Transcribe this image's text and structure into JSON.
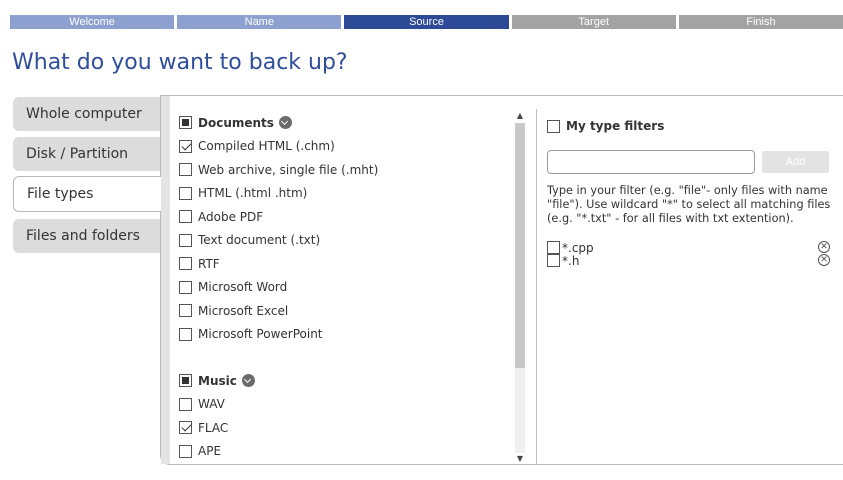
{
  "wizard": {
    "steps": [
      {
        "label": "Welcome",
        "state": "done"
      },
      {
        "label": "Name",
        "state": "done"
      },
      {
        "label": "Source",
        "state": "active"
      },
      {
        "label": "Target",
        "state": "todo"
      },
      {
        "label": "Finish",
        "state": "todo"
      }
    ]
  },
  "page_title": "What do you want to back up?",
  "sidebar": {
    "items": [
      {
        "label": "Whole computer",
        "selected": false
      },
      {
        "label": "Disk / Partition",
        "selected": false
      },
      {
        "label": "File types",
        "selected": true
      },
      {
        "label": "Files and folders",
        "selected": false
      }
    ]
  },
  "types": {
    "documents": {
      "label": "Documents",
      "state": "partial",
      "items": [
        {
          "label": "Compiled HTML (.chm)",
          "checked": true
        },
        {
          "label": "Web archive, single file (.mht)",
          "checked": false
        },
        {
          "label": "HTML (.html .htm)",
          "checked": false
        },
        {
          "label": "Adobe PDF",
          "checked": false
        },
        {
          "label": "Text document (.txt)",
          "checked": false
        },
        {
          "label": "RTF",
          "checked": false
        },
        {
          "label": "Microsoft Word",
          "checked": false
        },
        {
          "label": "Microsoft Excel",
          "checked": false
        },
        {
          "label": "Microsoft PowerPoint",
          "checked": false
        }
      ]
    },
    "music": {
      "label": "Music",
      "state": "partial",
      "items": [
        {
          "label": "WAV",
          "checked": false
        },
        {
          "label": "FLAC",
          "checked": true
        },
        {
          "label": "APE",
          "checked": false
        }
      ]
    }
  },
  "filters": {
    "header": "My type filters",
    "input_value": "",
    "add_label": "Add",
    "help": "Type in your filter (e.g. \"file\"- only files with name \"file\"). Use wildcard \"*\" to select all matching files (e.g. \"*.txt\" - for all files with txt extention).",
    "items": [
      {
        "label": "*.cpp",
        "checked": false
      },
      {
        "label": "*.h",
        "checked": false
      }
    ]
  },
  "colors": {
    "step_done": "#8da0d0",
    "step_active": "#2d4a97",
    "step_todo": "#a3a3a3",
    "title": "#2f4d99"
  }
}
